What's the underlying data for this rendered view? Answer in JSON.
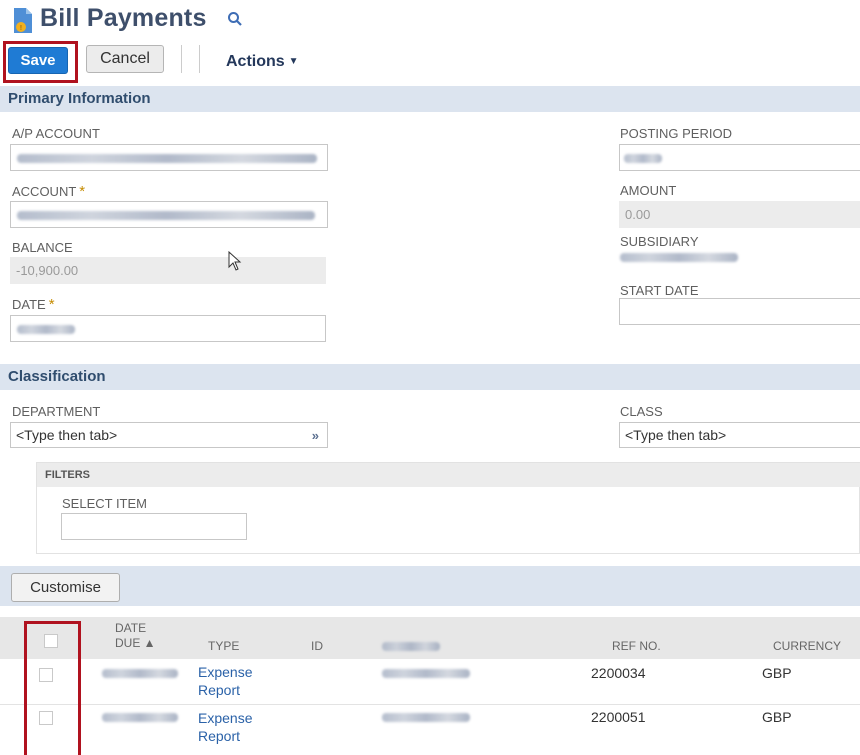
{
  "header": {
    "title": "Bill Payments"
  },
  "toolbar": {
    "save_label": "Save",
    "cancel_label": "Cancel",
    "actions_label": "Actions"
  },
  "sections": {
    "primary": "Primary Information",
    "classification": "Classification"
  },
  "primary": {
    "ap_account_label": "A/P ACCOUNT",
    "account_label": "ACCOUNT",
    "balance_label": "BALANCE",
    "balance_value": "-10,900.00",
    "date_label": "DATE",
    "posting_period_label": "POSTING PERIOD",
    "amount_label": "AMOUNT",
    "amount_value": "0.00",
    "subsidiary_label": "SUBSIDIARY",
    "start_date_label": "START DATE",
    "required_marker": "*"
  },
  "classification": {
    "department_label": "DEPARTMENT",
    "department_value": "<Type then tab>",
    "class_label": "CLASS",
    "class_value": "<Type then tab>",
    "filters_label": "FILTERS",
    "select_item_label": "SELECT ITEM"
  },
  "sublist": {
    "customise_label": "Customise",
    "columns": {
      "date_due_line1": "DATE",
      "date_due_line2": "DUE ▲",
      "type": "TYPE",
      "id": "ID",
      "ref_no": "REF NO.",
      "currency": "CURRENCY"
    },
    "rows": [
      {
        "type_line1": "Expense",
        "type_line2": "Report",
        "ref_no": "2200034",
        "currency": "GBP"
      },
      {
        "type_line1": "Expense",
        "type_line2": "Report",
        "ref_no": "2200051",
        "currency": "GBP"
      }
    ]
  },
  "icons": {
    "page": "bill-payment-document-icon",
    "search": "search-icon",
    "dropdown": "double-chevron-down-icon"
  },
  "colors": {
    "primary_button": "#1f7bd4",
    "section_header": "#dce4ef",
    "highlight_box": "#b0121f",
    "title": "#3e4f6b",
    "link": "#2b62a8"
  }
}
